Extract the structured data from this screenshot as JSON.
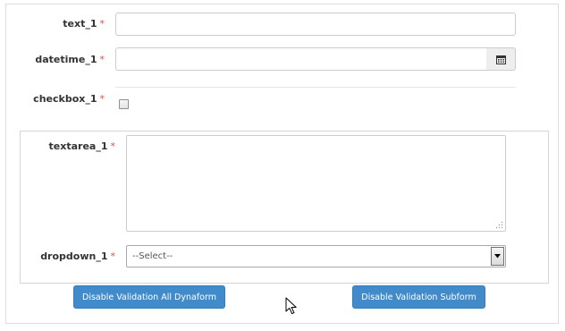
{
  "fields": {
    "text_1": {
      "label": "text_1",
      "required_mark": "*",
      "value": ""
    },
    "datetime_1": {
      "label": "datetime_1",
      "required_mark": "*",
      "value": "",
      "addon_icon": "calendar-icon"
    },
    "checkbox_1": {
      "label": "checkbox_1",
      "required_mark": "*",
      "checked": false
    },
    "textarea_1": {
      "label": "textarea_1",
      "required_mark": "*",
      "value": ""
    },
    "dropdown_1": {
      "label": "dropdown_1",
      "required_mark": "*",
      "selected": "--Select--"
    }
  },
  "buttons": {
    "disable_all": "Disable Validation All Dynaform",
    "disable_subform": "Disable Validation Subform"
  },
  "colors": {
    "required": "#d9534f",
    "button_bg": "#428bca",
    "button_text": "#ffffff"
  }
}
